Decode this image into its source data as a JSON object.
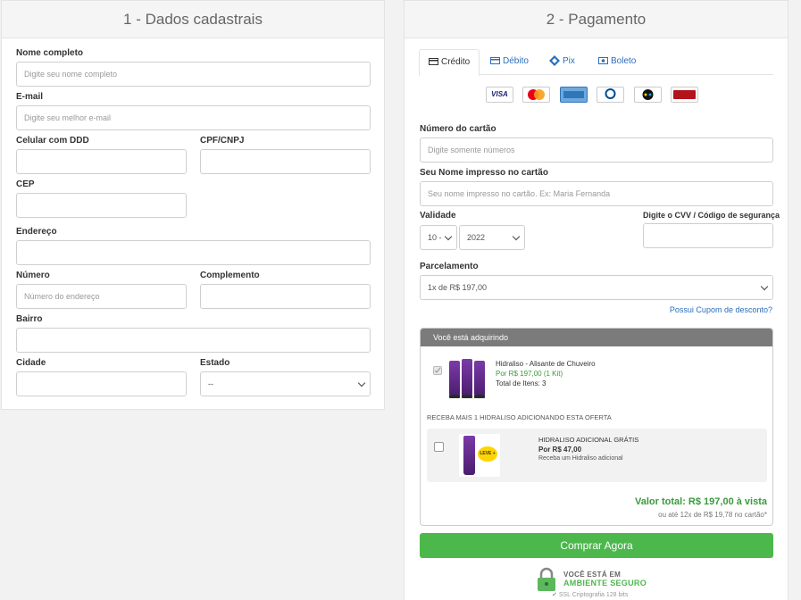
{
  "left": {
    "title": "1 - Dados cadastrais",
    "fields": {
      "nome_label": "Nome completo",
      "nome_placeholder": "Digite seu nome completo",
      "email_label": "E-mail",
      "email_placeholder": "Digite seu melhor e-mail",
      "celular_label": "Celular com DDD",
      "cpf_label": "CPF/CNPJ",
      "cep_label": "CEP",
      "endereco_label": "Endereço",
      "numero_label": "Número",
      "numero_placeholder": "Número do endereço",
      "complemento_label": "Complemento",
      "bairro_label": "Bairro",
      "cidade_label": "Cidade",
      "estado_label": "Estado",
      "estado_value": "--"
    }
  },
  "right": {
    "title": "2 - Pagamento",
    "tabs": [
      {
        "label": "Crédito",
        "icon": "credit-card-icon"
      },
      {
        "label": "Débito",
        "icon": "debit-card-icon"
      },
      {
        "label": "Pix",
        "icon": "pix-icon"
      },
      {
        "label": "Boleto",
        "icon": "boleto-icon"
      }
    ],
    "card_brands": [
      {
        "name": "VISA",
        "color": "#1a1f71"
      },
      {
        "name": "MasterCard",
        "color": "#eb001b"
      },
      {
        "name": "American Express",
        "color": "#2e77bb"
      },
      {
        "name": "Diners Club",
        "color": "#004a97"
      },
      {
        "name": "elo",
        "color": "#000000"
      },
      {
        "name": "Hipercard",
        "color": "#b3131b"
      }
    ],
    "card_number_label": "Número do cartão",
    "card_number_placeholder": "Digite somente números",
    "card_name_label": "Seu Nome impresso no cartão",
    "card_name_placeholder": "Seu nome impresso no cartão. Ex: Maria Fernanda",
    "validade_label": "Validade",
    "month_value": "10 -",
    "year_value": "2022",
    "cvv_label": "Digite o CVV / Código de segurança",
    "parcelamento_label": "Parcelamento",
    "parcelamento_value": "1x de R$ 197,00",
    "coupon_link": "Possui Cupom de desconto?",
    "summary": {
      "header": "Você está adquirindo",
      "product_name": "Hidraliso - Alisante de Chuveiro",
      "product_price": "Por R$ 197,00 (1 Kit)",
      "product_items": "Total de Itens: 3",
      "offer_title": "RECEBA MAIS 1 HIDRALISO ADICIONANDO ESTA OFERTA",
      "offer_name": "HIDRALISO ADICIONAL GRÁTIS",
      "offer_price": "Por R$ 47,00",
      "offer_desc": "Receba um Hidraliso adicional",
      "offer_badge": "LEVE +",
      "total": "Valor total: R$ 197,00 à vista",
      "installments": "ou até 12x de R$ 19,78 no cartão*"
    },
    "buy_button": "Comprar Agora",
    "secure_line1": "VOCÊ ESTÁ EM",
    "secure_line2": "AMBIENTE SEGURO",
    "secure_line3": "SSL Criptografia 128 bits"
  }
}
